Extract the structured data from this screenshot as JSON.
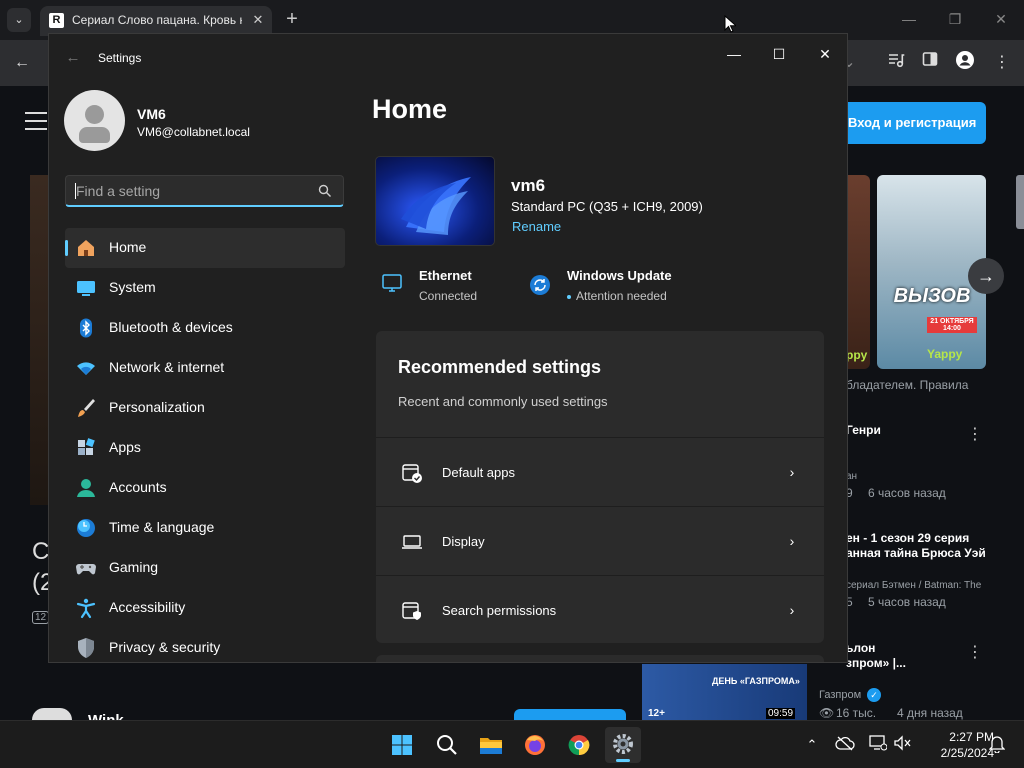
{
  "browser": {
    "tab_title": "Сериал Слово пацана. Кровь на асфальте",
    "tab_favicon": "R",
    "login_button": "Вход и регистрация",
    "poster_title": "ВЫЗОВ",
    "poster_date": "21 ОКТЯБРЯ 14:00",
    "poster_brand": "Yappy",
    "poster_brand2": "ppy",
    "text_rights": "бладателем. Правила",
    "video1_title": "Генри",
    "video1_channel": "ан",
    "video1_views": "9",
    "video1_time": "6 часов назад",
    "video2_title_l1": "ен - 1 сезон 29 серия",
    "video2_title_l2": "анная тайна Брюса Уэй",
    "video2_channel": "сериал Бэтмен / Batman: The",
    "video2_views": "5",
    "video2_time": "5 часов назад",
    "video3_title_l1": "ьлон",
    "video3_title_l2": "зпром» |...",
    "video3_channel": "Газпром",
    "video3_views": "16 тыс.",
    "video3_time": "4 дня назад",
    "video3_thumb_text": "ДЕНЬ «ГАЗПРОМА»",
    "video3_age": "12+",
    "video3_duration": "09:59",
    "left_big_text_1": "С",
    "left_big_text_2": "(2",
    "left_small_badge": "12",
    "channel_name": "Wink"
  },
  "settings": {
    "window_title": "Settings",
    "user": {
      "name": "VM6",
      "email": "VM6@collabnet.local"
    },
    "search_placeholder": "Find a setting",
    "nav": [
      {
        "label": "Home",
        "icon": "home-icon",
        "active": true
      },
      {
        "label": "System",
        "icon": "system-icon"
      },
      {
        "label": "Bluetooth & devices",
        "icon": "bluetooth-icon"
      },
      {
        "label": "Network & internet",
        "icon": "wifi-icon"
      },
      {
        "label": "Personalization",
        "icon": "brush-icon"
      },
      {
        "label": "Apps",
        "icon": "apps-icon"
      },
      {
        "label": "Accounts",
        "icon": "accounts-icon"
      },
      {
        "label": "Time & language",
        "icon": "time-language-icon"
      },
      {
        "label": "Gaming",
        "icon": "gaming-icon"
      },
      {
        "label": "Accessibility",
        "icon": "accessibility-icon"
      },
      {
        "label": "Privacy & security",
        "icon": "shield-icon"
      }
    ],
    "page_title": "Home",
    "device": {
      "name": "vm6",
      "model": "Standard PC (Q35 + ICH9, 2009)",
      "rename": "Rename"
    },
    "status": [
      {
        "title": "Ethernet",
        "sub": "Connected"
      },
      {
        "title": "Windows Update",
        "sub": "Attention needed"
      }
    ],
    "recommended": {
      "title": "Recommended settings",
      "subtitle": "Recent and commonly used settings",
      "items": [
        {
          "label": "Default apps"
        },
        {
          "label": "Display"
        },
        {
          "label": "Search permissions"
        }
      ]
    }
  },
  "taskbar": {
    "time": "2:27 PM",
    "date": "2/25/2024"
  },
  "colors": {
    "accent": "#60cdff",
    "brand_blue": "#1c9cf0"
  }
}
